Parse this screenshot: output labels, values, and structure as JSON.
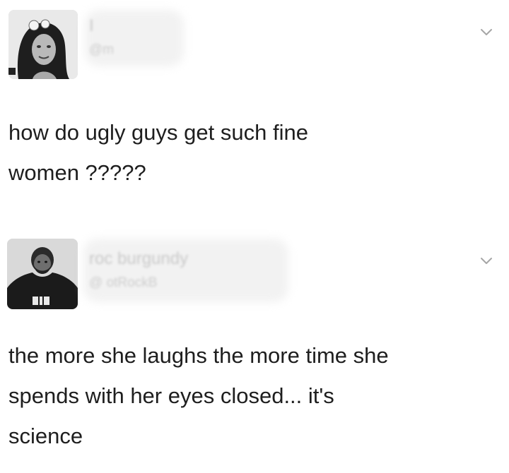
{
  "tweets": [
    {
      "display_name": "I",
      "handle": "@m",
      "text_lines": [
        "how do ugly guys get such fine",
        "women ?????"
      ]
    },
    {
      "display_name": "roc  burgundy",
      "handle": "@ otRockB",
      "text_lines": [
        "the more she laughs the more time she",
        "spends with her eyes closed... it's",
        "science"
      ]
    }
  ]
}
